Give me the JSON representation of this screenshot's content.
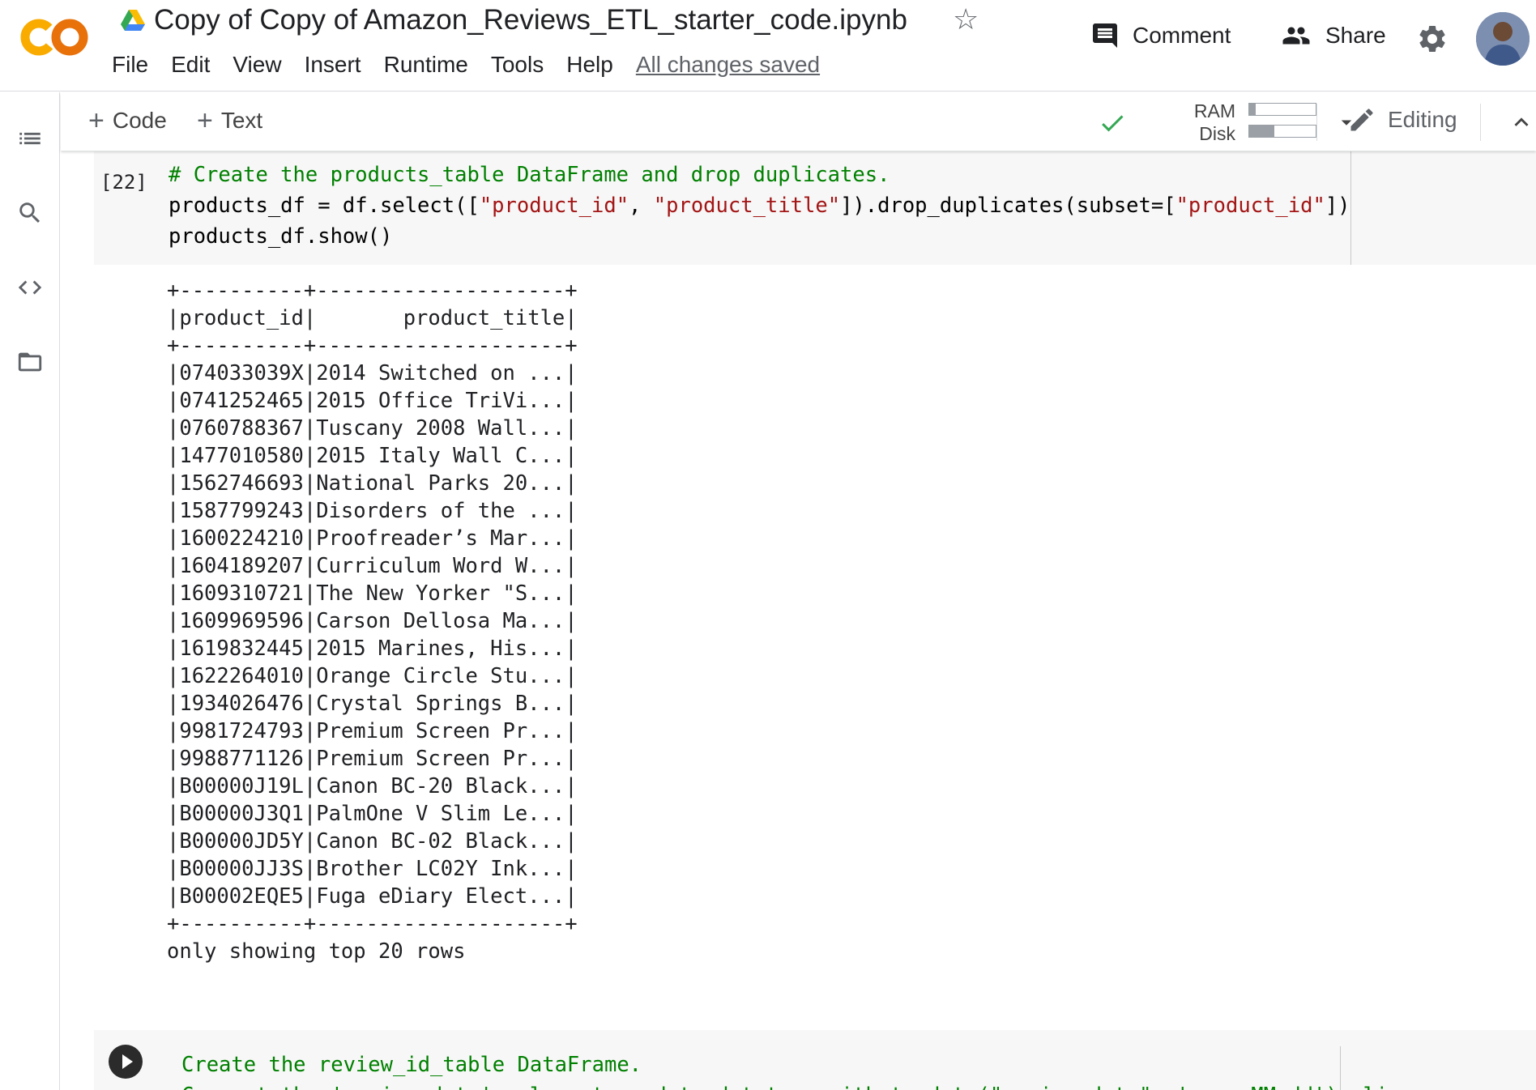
{
  "header": {
    "title": "Copy of Copy of Amazon_Reviews_ETL_starter_code.ipynb",
    "menu": [
      "File",
      "Edit",
      "View",
      "Insert",
      "Runtime",
      "Tools",
      "Help"
    ],
    "save_status": "All changes saved",
    "comment_label": "Comment",
    "share_label": "Share"
  },
  "toolbar": {
    "add_code_label": "Code",
    "add_text_label": "Text",
    "ram_label": "RAM",
    "disk_label": "Disk",
    "ram_usage_fraction": 0.1,
    "disk_usage_fraction": 0.38,
    "editing_label": "Editing"
  },
  "cell": {
    "exec_count": "[22]",
    "comment_line": "# Create the products_table DataFrame and drop duplicates.",
    "line2_a": "products_df = df.select([",
    "line2_s1": "\"product_id\"",
    "line2_b": ", ",
    "line2_s2": "\"product_title\"",
    "line2_c": "]).drop_duplicates(subset=[",
    "line2_s3": "\"product_id\"",
    "line2_d": "])",
    "line3": "products_df.show()"
  },
  "output": {
    "border": "+----------+--------------------+",
    "header_row": "|product_id|       product_title|",
    "rows": [
      "|074033039X|2014 Switched on ...|",
      "|0741252465|2015 Office TriVi...|",
      "|0760788367|Tuscany 2008 Wall...|",
      "|1477010580|2015 Italy Wall C...|",
      "|1562746693|National Parks 20...|",
      "|1587799243|Disorders of the ...|",
      "|1600224210|Proofreader’s Mar...|",
      "|1604189207|Curriculum Word W...|",
      "|1609310721|The New Yorker \"S...|",
      "|1609969596|Carson Dellosa Ma...|",
      "|1619832445|2015 Marines, His...|",
      "|1622264010|Orange Circle Stu...|",
      "|1934026476|Crystal Springs B...|",
      "|9981724793|Premium Screen Pr...|",
      "|9988771126|Premium Screen Pr...|",
      "|B00000J19L|Canon BC-20 Black...|",
      "|B00000J3Q1|PalmOne V Slim Le...|",
      "|B00000JD5Y|Canon BC-02 Black...|",
      "|B00000JJ3S|Brother LC02Y Ink...|",
      "|B00002EQE5|Fuga eDiary Elect...|"
    ],
    "footer": "only showing top 20 rows"
  },
  "next_cell": {
    "line1": "Create the review_id_table DataFrame.",
    "line2": "Convert the 'review_date' column to a date datatype with to_date(\"review_date\", 'yyyy-MM-dd').alias"
  },
  "colors": {
    "comment_green": "#008000",
    "string_red": "#a31515",
    "cell_bg": "#f7f7f7",
    "logo_orange": "#f9ab00",
    "logo_dark_orange": "#e8710a",
    "check_green": "#34a853"
  },
  "icons": {
    "logo": "colab-logo",
    "drive": "google-drive-icon",
    "star": "star-outline-icon",
    "comment": "comment-icon",
    "share": "people-icon",
    "settings": "gear-icon",
    "toc": "table-of-contents-icon",
    "search": "search-icon",
    "snippets": "code-icon",
    "files": "folder-icon",
    "check": "check-icon",
    "dropdown": "caret-down-icon",
    "edit": "pencil-icon",
    "collapse": "chevron-up-icon",
    "run": "play-icon"
  }
}
